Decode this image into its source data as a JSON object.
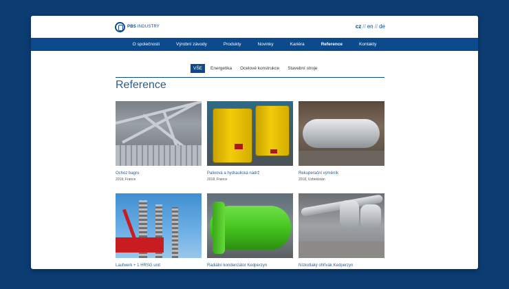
{
  "brand": {
    "logo_bold": "PBS",
    "logo_text": "INDUSTRY"
  },
  "languages": [
    {
      "code": "cz",
      "active": true
    },
    {
      "code": "en",
      "active": false
    },
    {
      "code": "de",
      "active": false
    }
  ],
  "lang_separator": "//",
  "nav": [
    {
      "label": "O společnosti"
    },
    {
      "label": "Výrobní závody"
    },
    {
      "label": "Produkty"
    },
    {
      "label": "Novinky"
    },
    {
      "label": "Kariéra"
    },
    {
      "label": "Reference",
      "active": true
    },
    {
      "label": "Kontakty"
    }
  ],
  "filters": [
    {
      "label": "VŠE",
      "active": true
    },
    {
      "label": "Energetika"
    },
    {
      "label": "Ocelové konstrukce"
    },
    {
      "label": "Stavební stroje"
    }
  ],
  "page_title": "Reference",
  "cards": [
    {
      "title": "Ochoz bagru",
      "meta": "2018, France",
      "image": "steel-frame"
    },
    {
      "title": "Palivová a hydraulická nádrž",
      "meta": "2018, France",
      "image": "yellow-tanks"
    },
    {
      "title": "Rekuperační výměník",
      "meta": "2018, Uzbekistán",
      "image": "steel-cylinder"
    },
    {
      "title": "Laufwerk + 1 HRSG unit",
      "meta": "",
      "image": "crane-structure"
    },
    {
      "title": "Radiální kondenzátor Kedperzyn",
      "meta": "",
      "image": "green-exchanger"
    },
    {
      "title": "Nízkotlaký ohřívák Kedperzyn",
      "meta": "",
      "image": "pipe-assembly"
    }
  ],
  "colors": {
    "brand": "#0b4a8c",
    "background": "#0b3d73",
    "title": "#2c5a8c"
  }
}
